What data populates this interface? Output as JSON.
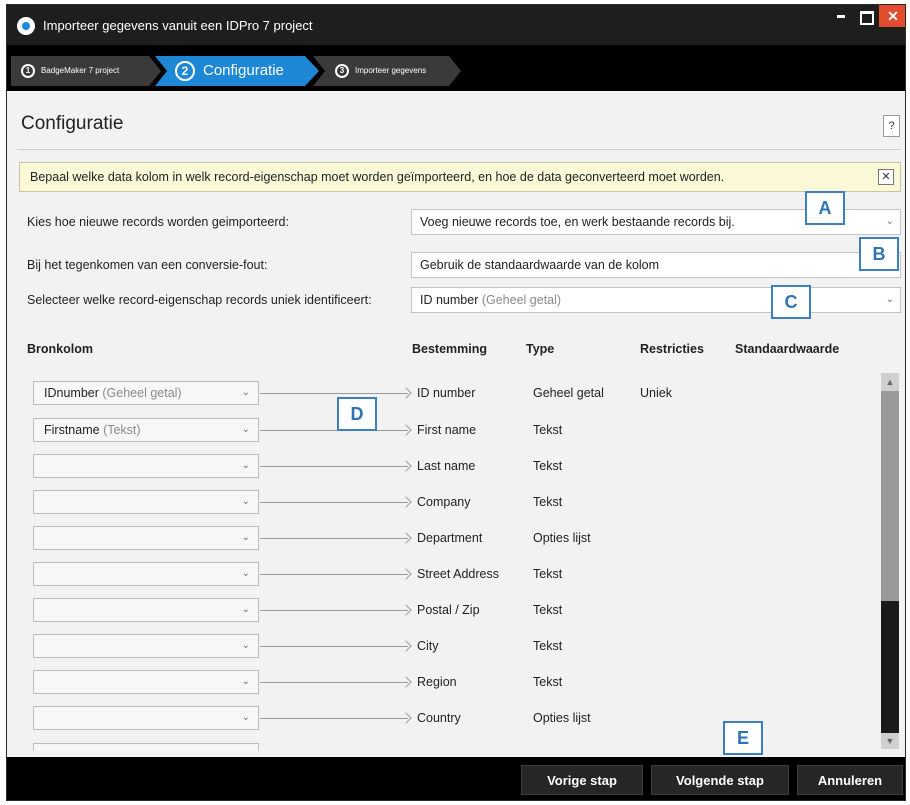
{
  "window": {
    "title": "Importeer gegevens vanuit een IDPro 7 project",
    "close_glyph": "✕"
  },
  "steps": [
    {
      "number": "1",
      "label": "BadgeMaker 7 project"
    },
    {
      "number": "2",
      "label": "Configuratie"
    },
    {
      "number": "3",
      "label": "Importeer gegevens"
    }
  ],
  "panel": {
    "title": "Configuratie",
    "help_label": "?"
  },
  "banner": {
    "text": "Bepaal welke data kolom in welk record-eigenschap moet worden geïmporteerd, en hoe de data geconverteerd moet worden.",
    "close_glyph": "✕"
  },
  "options": {
    "import_mode_label": "Kies hoe nieuwe records worden geimporteerd:",
    "import_mode_value": "Voeg nieuwe records toe, en werk bestaande records bij.",
    "conversion_error_label": "Bij het tegenkomen van een conversie-fout:",
    "conversion_error_value": "Gebruik de standaardwaarde van de kolom",
    "unique_label": "Selecteer welke record-eigenschap records uniek identificeert:",
    "unique_value": "ID number",
    "unique_hint": "(Geheel getal)"
  },
  "callouts": {
    "a": "A",
    "b": "B",
    "c": "C",
    "d": "D",
    "e": "E"
  },
  "columns": {
    "source": "Bronkolom",
    "destination": "Bestemming",
    "type": "Type",
    "restrictions": "Restricties",
    "default": "Standaardwaarde"
  },
  "rows": [
    {
      "source": "IDnumber",
      "source_hint": "(Geheel getal)",
      "destination": "ID number",
      "type": "Geheel getal",
      "restriction": "Uniek"
    },
    {
      "source": "Firstname",
      "source_hint": "(Tekst)",
      "destination": "First name",
      "type": "Tekst",
      "restriction": ""
    },
    {
      "source": "",
      "source_hint": "",
      "destination": "Last name",
      "type": "Tekst",
      "restriction": ""
    },
    {
      "source": "",
      "source_hint": "",
      "destination": "Company",
      "type": "Tekst",
      "restriction": ""
    },
    {
      "source": "",
      "source_hint": "",
      "destination": "Department",
      "type": "Opties lijst",
      "restriction": ""
    },
    {
      "source": "",
      "source_hint": "",
      "destination": "Street Address",
      "type": "Tekst",
      "restriction": ""
    },
    {
      "source": "",
      "source_hint": "",
      "destination": "Postal / Zip",
      "type": "Tekst",
      "restriction": ""
    },
    {
      "source": "",
      "source_hint": "",
      "destination": "City",
      "type": "Tekst",
      "restriction": ""
    },
    {
      "source": "",
      "source_hint": "",
      "destination": "Region",
      "type": "Tekst",
      "restriction": ""
    },
    {
      "source": "",
      "source_hint": "",
      "destination": "Country",
      "type": "Opties lijst",
      "restriction": ""
    }
  ],
  "footer": {
    "previous": "Vorige stap",
    "next": "Volgende stap",
    "cancel": "Annuleren"
  },
  "colors": {
    "accent": "#1e88d6",
    "callout": "#2e75b6",
    "banner": "#fbf8d8",
    "close": "#e44c2f"
  }
}
